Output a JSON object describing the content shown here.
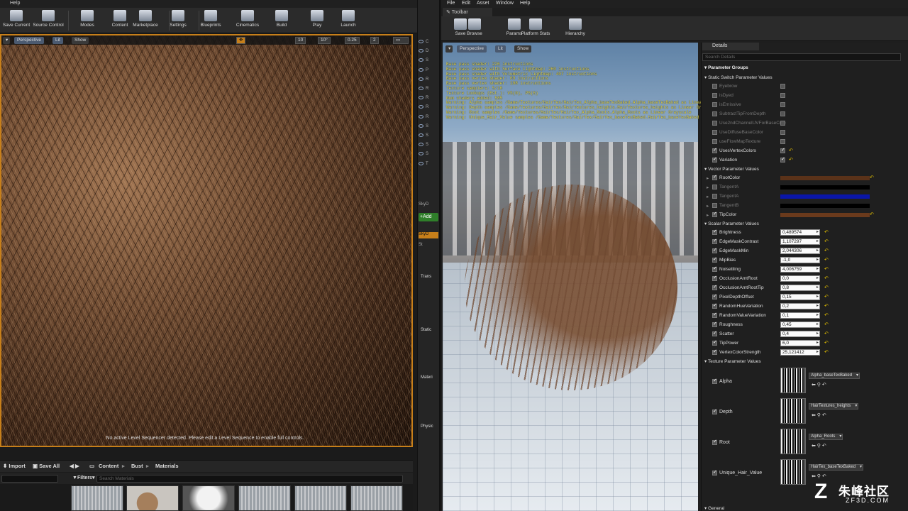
{
  "left_editor": {
    "menu_help": "Help",
    "toolbar": [
      {
        "label": "Save Current",
        "icon": "save-icon"
      },
      {
        "label": "Source Control",
        "icon": "source-control-icon"
      },
      {
        "label": "Modes",
        "icon": "modes-icon"
      },
      {
        "label": "Content",
        "icon": "content-icon"
      },
      {
        "label": "Marketplace",
        "icon": "marketplace-icon"
      },
      {
        "label": "Settings",
        "icon": "settings-icon"
      },
      {
        "label": "Blueprints",
        "icon": "blueprints-icon"
      },
      {
        "label": "Cinematics",
        "icon": "cinematics-icon"
      },
      {
        "label": "Build",
        "icon": "build-icon"
      },
      {
        "label": "Play",
        "icon": "play-icon"
      },
      {
        "label": "Launch",
        "icon": "launch-icon"
      }
    ],
    "viewport": {
      "perspective": "Perspective",
      "lit": "Lit",
      "show": "Show",
      "snap_grid": "10",
      "snap_angle": "10°",
      "snap_scale": "0.25",
      "camera_speed": "2",
      "sequencer_message": "No active Level Sequencer detected. Please edit a Level Sequence to enable full controls."
    },
    "content_browser": {
      "import": "Import",
      "save_all": "Save All",
      "path": [
        "Content",
        "Bust",
        "Materials"
      ],
      "filters": "Filters",
      "search_placeholder": "Search Materials"
    }
  },
  "middle_strip": {
    "letters": [
      "C",
      "D",
      "S",
      "P",
      "R",
      "R",
      "R",
      "R",
      "R",
      "S",
      "S",
      "S",
      "S",
      "T"
    ],
    "sky_items": [
      "SkyD",
      "SkyD",
      "St"
    ],
    "add_label": "Add",
    "sections": [
      "Trans",
      "Static",
      "Materi",
      "Physic"
    ]
  },
  "right_editor": {
    "menu": [
      "File",
      "Edit",
      "Asset",
      "Window",
      "Help"
    ],
    "tab_title": "Toolbar",
    "toolbar": [
      {
        "label": "Save",
        "icon": "save-icon"
      },
      {
        "label": "Browse",
        "icon": "browse-icon"
      },
      {
        "label": "Params",
        "icon": "params-icon"
      },
      {
        "label": "Platform Stats",
        "icon": "platform-stats-icon"
      },
      {
        "label": "Hierarchy",
        "icon": "hierarchy-icon"
      }
    ],
    "viewport": {
      "perspective": "Perspective",
      "lit": "Lit",
      "show": "Show",
      "stats": [
        "Base pass shader: 226 instructions",
        "Base pass shader with Surface Lightmap: 260 instructions",
        "Base pass shader with Volumetric Lightmap: 407 instructions",
        "Base pass vertex shader: 69 instructions",
        "Base pass vertex shader: 198 instructions",
        "Texture samplers: 5/16",
        "Texture Lookups (Est.): VS(0), PS(6)",
        "Num shaders added: 585",
        "Warning: Alpha samples /Game/Textures/HairTex/HairTex_Alpha_baseTexBaked.Alpha_baseTexBaked as Linear Grayscale",
        "Warning: Depth samples /Game/Textures/HairTex/HairTextures_heights.HairTextures_heights as Linear Grayscale",
        "Warning: Root samples /Game/Textures/HairTex/HairTex_Alpha_Roots.Alpha_Roots as Linear Grayscale",
        "Warning: Unique_Hair_Value samples /Game/Textures/HairTex/HairTex_baseTexBaked.HairTex_baseTexBaked as Linear Grayscale"
      ]
    },
    "details": {
      "tab": "Details",
      "search_placeholder": "Search Details",
      "parameter_groups": "Parameter Groups",
      "static_switch_header": "Static Switch Parameter Values",
      "static_switches": [
        {
          "name": "Eyebrow",
          "enabled": false,
          "value": false
        },
        {
          "name": "isDyed",
          "enabled": false,
          "value": false
        },
        {
          "name": "isEmissive",
          "enabled": false,
          "value": false
        },
        {
          "name": "SubtractTipFromDepth",
          "enabled": false,
          "value": false
        },
        {
          "name": "Use2ndChannelUVForBaseColo",
          "enabled": false,
          "value": false
        },
        {
          "name": "UseDiffuseBaseColor",
          "enabled": false,
          "value": false
        },
        {
          "name": "useFlowMapTexture",
          "enabled": false,
          "value": false
        },
        {
          "name": "UsesVertexColors",
          "enabled": true,
          "value": true
        },
        {
          "name": "Variation",
          "enabled": true,
          "value": true
        }
      ],
      "vector_header": "Vector Parameter Values",
      "vectors": [
        {
          "name": "RootColor",
          "enabled": true,
          "color": "#5a3219"
        },
        {
          "name": "TangentA",
          "enabled": false,
          "color": "#000000"
        },
        {
          "name": "TangentA",
          "enabled": false,
          "color": "#0a16a8"
        },
        {
          "name": "TangentB",
          "enabled": false,
          "color": "#000000"
        },
        {
          "name": "TipColor",
          "enabled": true,
          "color": "#6a3a1c"
        }
      ],
      "scalar_header": "Scalar Parameter Values",
      "scalars": [
        {
          "name": "Brightness",
          "value": "0,489574"
        },
        {
          "name": "EdgeMaskContrast",
          "value": "1,107297"
        },
        {
          "name": "EdgeMaskMin",
          "value": "2,044306"
        },
        {
          "name": "MipBias",
          "value": "-1,0"
        },
        {
          "name": "Noisetiling",
          "value": "4,006759"
        },
        {
          "name": "OcclusionAmtRoot",
          "value": "0,0"
        },
        {
          "name": "OcclusionAmtRootTip",
          "value": "0,8"
        },
        {
          "name": "PixelDepthOffset",
          "value": "0,15"
        },
        {
          "name": "RandomHueVariation",
          "value": "0,2"
        },
        {
          "name": "RandomValueVariation",
          "value": "0,1"
        },
        {
          "name": "Roughness",
          "value": "0,45"
        },
        {
          "name": "Scatter",
          "value": "0,4"
        },
        {
          "name": "TipPower",
          "value": "6,0"
        },
        {
          "name": "VertexColorStrength",
          "value": "25,121412"
        }
      ],
      "texture_header": "Texture Parameter Values",
      "textures": [
        {
          "name": "Alpha",
          "asset": "Alpha_baseTexBaked"
        },
        {
          "name": "Depth",
          "asset": "HairTextures_heights"
        },
        {
          "name": "Root",
          "asset": "Alpha_Roots"
        },
        {
          "name": "Unique_Hair_Value",
          "asset": "HairTex_baseTexBaked"
        }
      ],
      "general_header": "General"
    }
  },
  "watermark": {
    "logo": "Z",
    "cn": "朱峰社区",
    "en": "ZF3D.COM"
  },
  "colors": {
    "accent_orange": "#c77f1a",
    "stats_yellow": "#e6d84a",
    "reset_arrow": "#e6c200",
    "add_green": "#2f7f2a"
  }
}
